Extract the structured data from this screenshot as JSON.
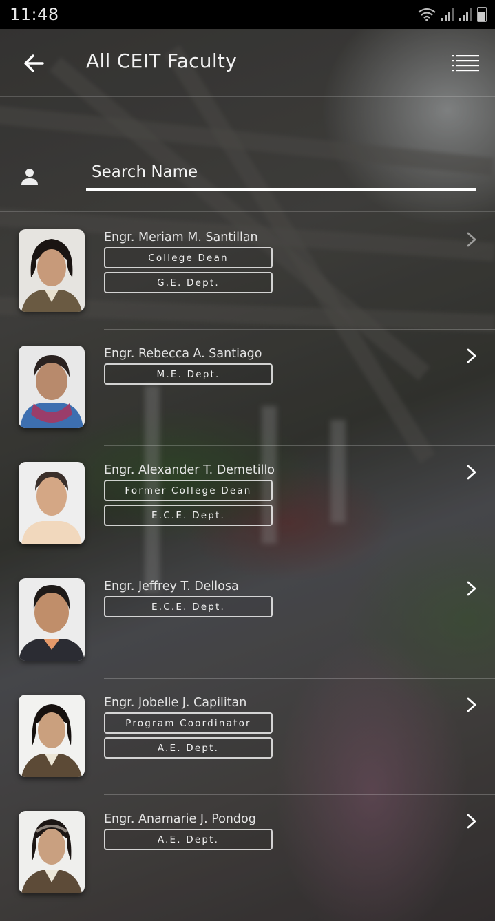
{
  "status_bar": {
    "time": "11:48"
  },
  "app_bar": {
    "title": "All CEIT Faculty",
    "back_icon": "arrow-left-icon",
    "menu_icon": "list-icon"
  },
  "search": {
    "placeholder": "Search Name",
    "value": "",
    "icon": "person-icon"
  },
  "faculty": [
    {
      "name": "Engr. Meriam M. Santillan",
      "tags": [
        "College Dean",
        "G.E. Dept."
      ]
    },
    {
      "name": "Engr. Rebecca A. Santiago",
      "tags": [
        "M.E. Dept."
      ]
    },
    {
      "name": "Engr. Alexander T. Demetillo",
      "tags": [
        "Former College Dean",
        "E.C.E. Dept."
      ]
    },
    {
      "name": "Engr. Jeffrey T. Dellosa",
      "tags": [
        "E.C.E. Dept."
      ]
    },
    {
      "name": "Engr. Jobelle J. Capilitan",
      "tags": [
        "Program Coordinator",
        "A.E. Dept."
      ]
    },
    {
      "name": "Engr. Anamarie J. Pondog",
      "tags": [
        "A.E. Dept."
      ]
    }
  ],
  "colors": {
    "status_bar": "#000000",
    "text": "#f2f2f2",
    "tag_border": "#ffffff"
  }
}
